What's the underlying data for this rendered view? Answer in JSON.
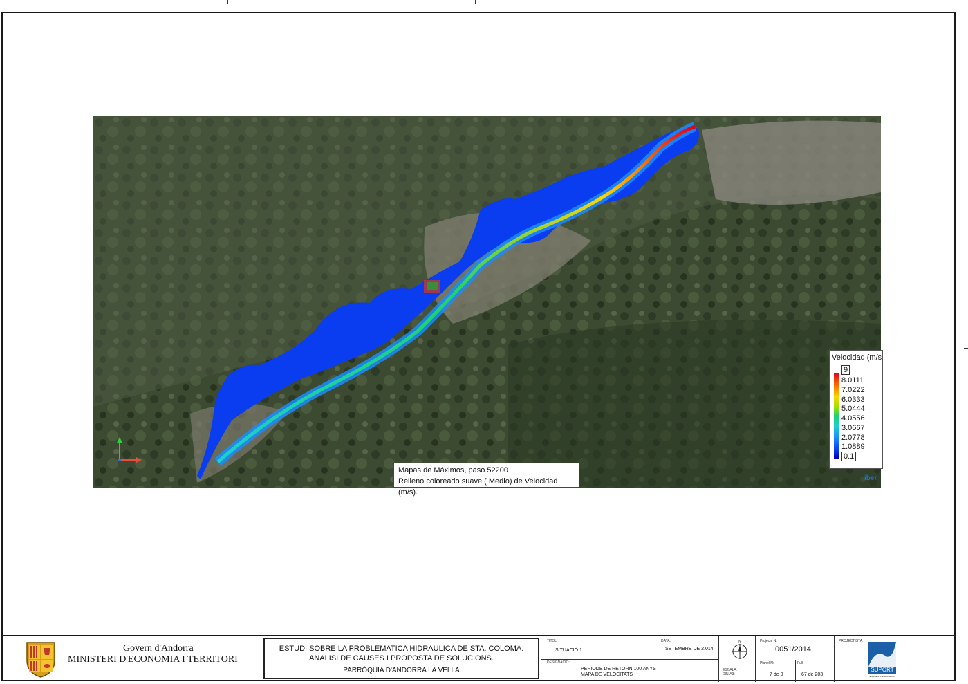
{
  "map": {
    "legend": {
      "title": "Velocidad (m/s",
      "max": "9",
      "values": [
        "8.0111",
        "7.0222",
        "6.0333",
        "5.0444",
        "4.0556",
        "3.0667",
        "2.0778",
        "1.0889"
      ],
      "min": "0.1",
      "colors": [
        "#e2001a",
        "#ff6a00",
        "#ffd400",
        "#9fe000",
        "#1fd36a",
        "#1ad0d0",
        "#1a8cff",
        "#0a3cf0",
        "#0000b4"
      ]
    },
    "brand": "iber",
    "caption_line1": "Mapas de Máximos, paso 52200",
    "caption_line2": "Relleno coloreado suave ( Medio) de Velocidad (m/s)."
  },
  "title_block": {
    "gov_line1": "Govern d'Andorra",
    "gov_line2": "MINISTERI D'ECONOMIA I TERRITORI",
    "study_line1": "ESTUDI SOBRE LA PROBLEMATICA HIDRAULICA DE STA. COLOMA.",
    "study_line2": "ANALISI DE CAUSES I PROPOSTA DE SOLUCIONS.",
    "study_line3": "PARRÒQUIA D'ANDORRA LA VELLA",
    "titol_label": "TITOL:",
    "titol": "SITUACIÓ 1",
    "data_label": "DATA:",
    "data": "SETEMBRE DE 2.014",
    "designacio_label": "DESIGNACIÓ:",
    "designacio_line1": "PERIODE DE RETORN 100 ANYS",
    "designacio_line2": "MAPA DE VELOCITATS",
    "escala_label": "ESCALA:",
    "escala_sub": "DIN-A3:",
    "escala": "- - -",
    "north": "N",
    "projecte_label": "Projecte N:",
    "projecte": "0051/2014",
    "planol_label": "Planol N:",
    "planol": "7 de 8",
    "full_label": "Full:",
    "full": "67  de  203",
    "projectista_label": "PROJECTISTA:",
    "logo_text": "SUPORT",
    "logo_sub": "Enginyeria Consultoria S.A."
  }
}
